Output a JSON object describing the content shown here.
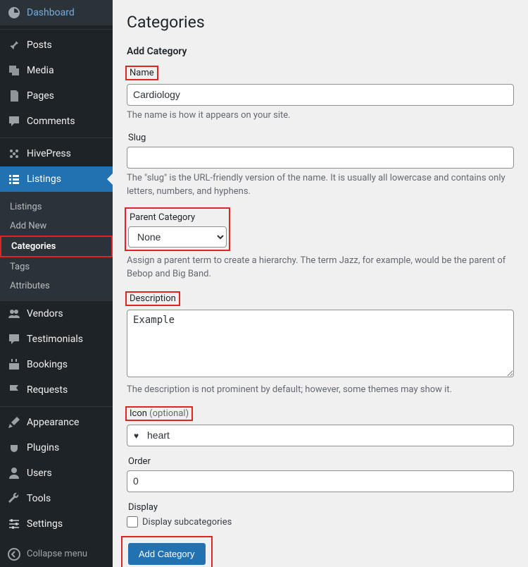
{
  "sidebar": {
    "items": [
      {
        "label": "Dashboard"
      },
      {
        "label": "Posts"
      },
      {
        "label": "Media"
      },
      {
        "label": "Pages"
      },
      {
        "label": "Comments"
      },
      {
        "label": "HivePress"
      },
      {
        "label": "Listings"
      },
      {
        "label": "Vendors"
      },
      {
        "label": "Testimonials"
      },
      {
        "label": "Bookings"
      },
      {
        "label": "Requests"
      },
      {
        "label": "Appearance"
      },
      {
        "label": "Plugins"
      },
      {
        "label": "Users"
      },
      {
        "label": "Tools"
      },
      {
        "label": "Settings"
      }
    ],
    "listings_submenu": [
      {
        "label": "Listings"
      },
      {
        "label": "Add New"
      },
      {
        "label": "Categories"
      },
      {
        "label": "Tags"
      },
      {
        "label": "Attributes"
      }
    ],
    "collapse": "Collapse menu"
  },
  "page": {
    "title": "Categories",
    "form_title": "Add Category"
  },
  "form": {
    "name": {
      "label": "Name",
      "value": "Cardiology",
      "help": "The name is how it appears on your site."
    },
    "slug": {
      "label": "Slug",
      "value": "",
      "help": "The \"slug\" is the URL-friendly version of the name. It is usually all lowercase and contains only letters, numbers, and hyphens."
    },
    "parent": {
      "label": "Parent Category",
      "value": "None",
      "help": "Assign a parent term to create a hierarchy. The term Jazz, for example, would be the parent of Bebop and Big Band."
    },
    "description": {
      "label": "Description",
      "value": "Example",
      "help": "The description is not prominent by default; however, some themes may show it."
    },
    "icon": {
      "label": "Icon ",
      "optional": "(optional)",
      "value": "heart"
    },
    "order": {
      "label": "Order",
      "value": "0"
    },
    "display": {
      "label": "Display",
      "checkbox": "Display subcategories"
    },
    "submit": "Add Category"
  }
}
